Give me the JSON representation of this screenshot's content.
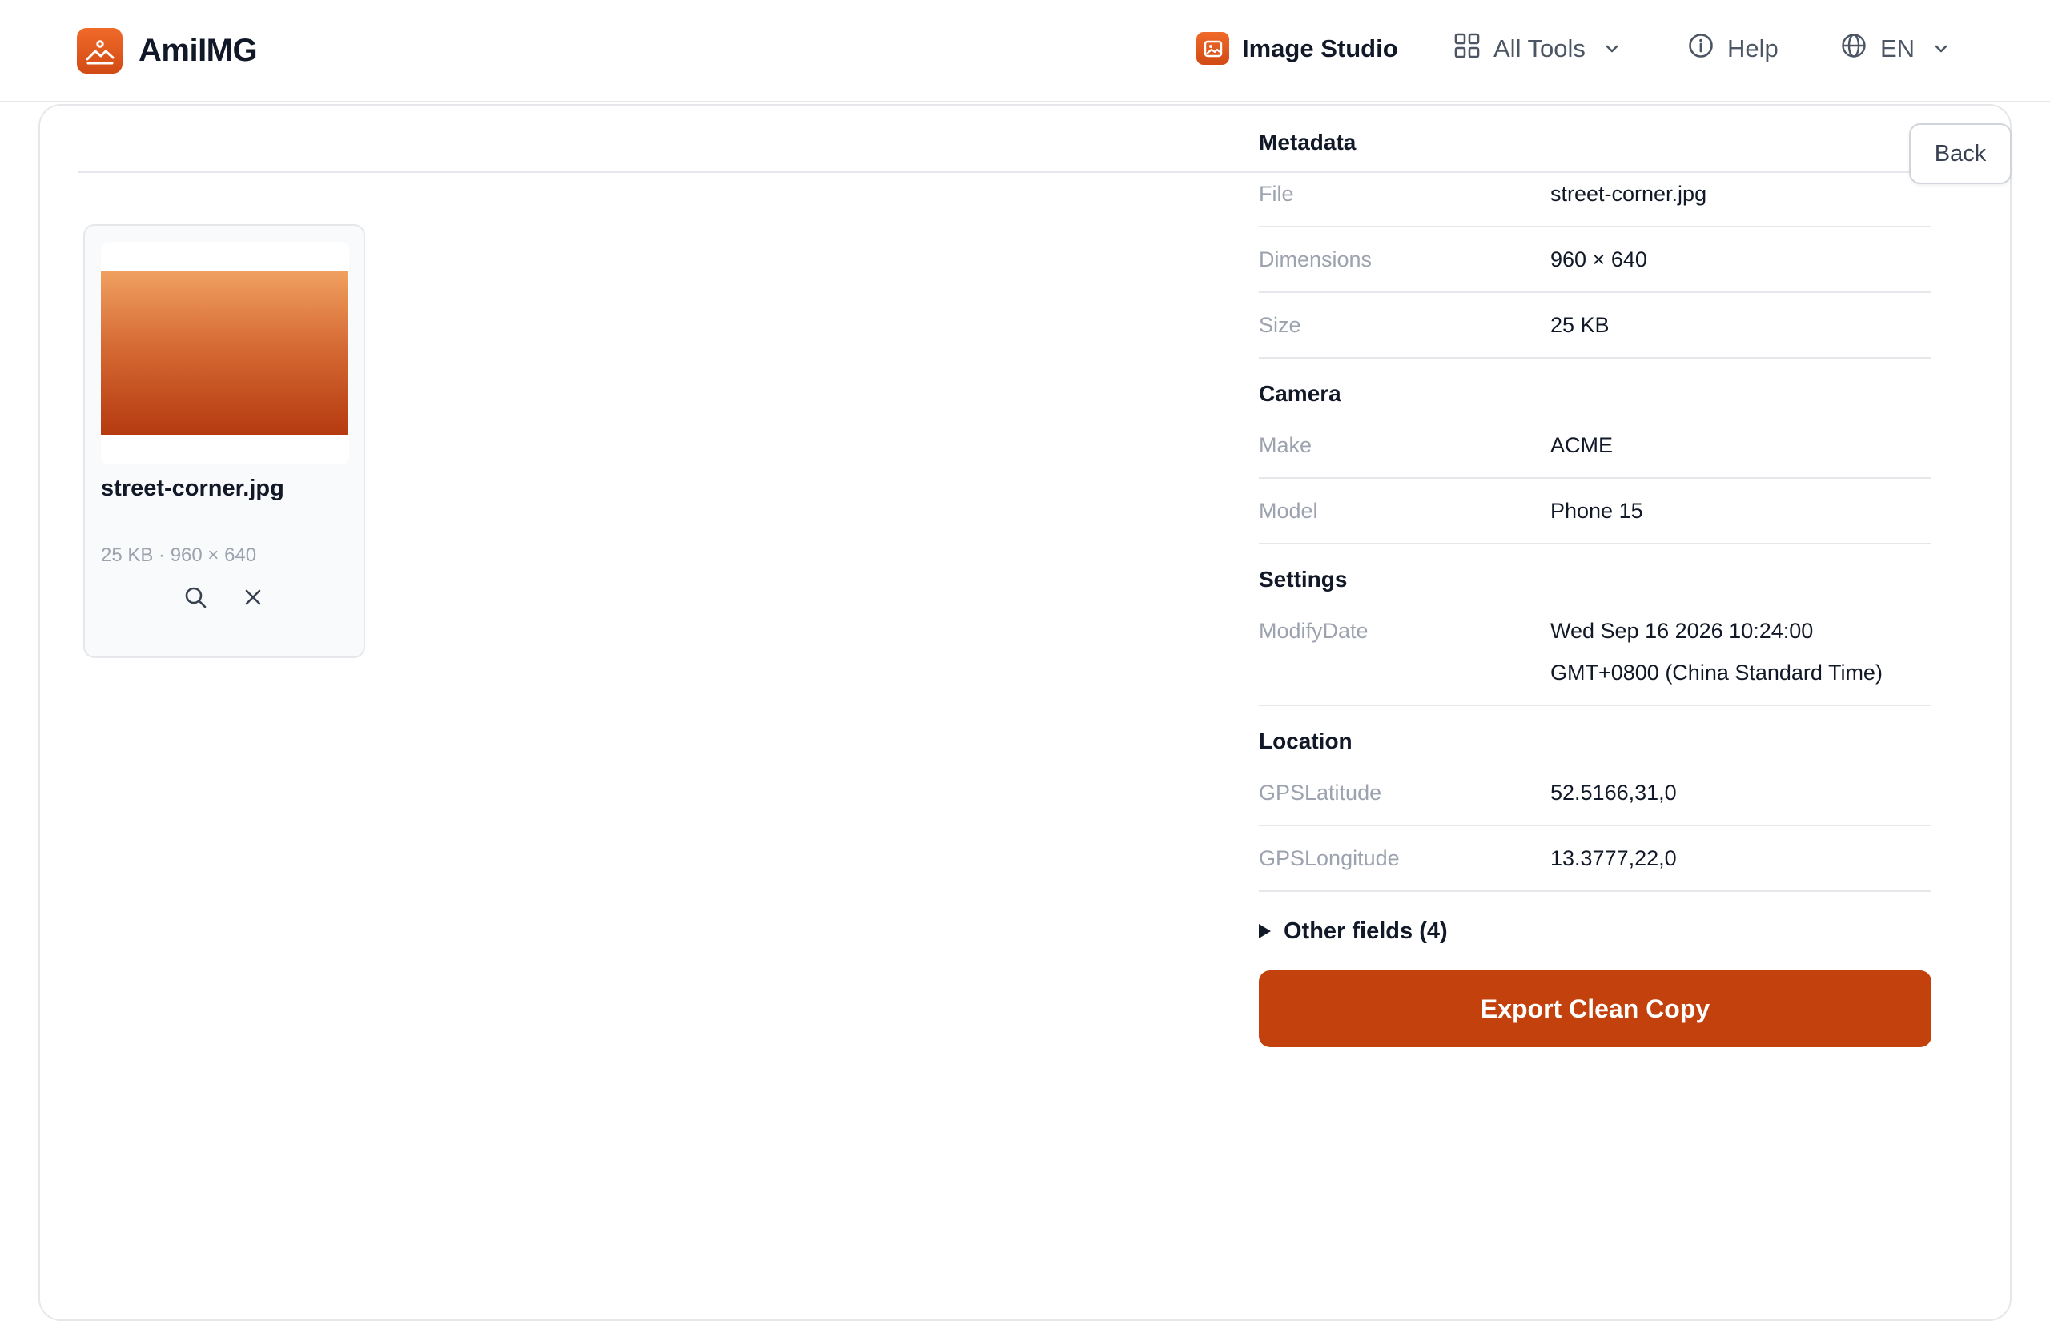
{
  "header": {
    "brand": "AmiIMG",
    "nav": {
      "studio": "Image Studio",
      "tools": "All Tools",
      "help": "Help",
      "lang": "EN"
    }
  },
  "toolbar": {
    "back_label": "Back"
  },
  "file_card": {
    "name": "street-corner.jpg",
    "meta": "25 KB · 960 × 640"
  },
  "metadata": {
    "title": "Metadata",
    "general": [
      {
        "key": "File",
        "value": "street-corner.jpg"
      },
      {
        "key": "Dimensions",
        "value": "960 × 640"
      },
      {
        "key": "Size",
        "value": "25 KB"
      }
    ],
    "camera": {
      "title": "Camera",
      "rows": [
        {
          "key": "Make",
          "value": "ACME"
        },
        {
          "key": "Model",
          "value": "Phone 15"
        }
      ]
    },
    "settings": {
      "title": "Settings",
      "rows": [
        {
          "key": "ModifyDate",
          "value_line1": "Wed Sep 16 2026 10:24:00",
          "value_line2": "GMT+0800 (China Standard Time)"
        }
      ]
    },
    "location": {
      "title": "Location",
      "rows": [
        {
          "key": "GPSLatitude",
          "value": "52.5166,31,0"
        },
        {
          "key": "GPSLongitude",
          "value": "13.3777,22,0"
        }
      ]
    },
    "other_fields": "Other fields (4)"
  },
  "actions": {
    "export_label": "Export Clean Copy"
  },
  "colors": {
    "accent": "#c2410c",
    "brand": "#e8591e"
  }
}
